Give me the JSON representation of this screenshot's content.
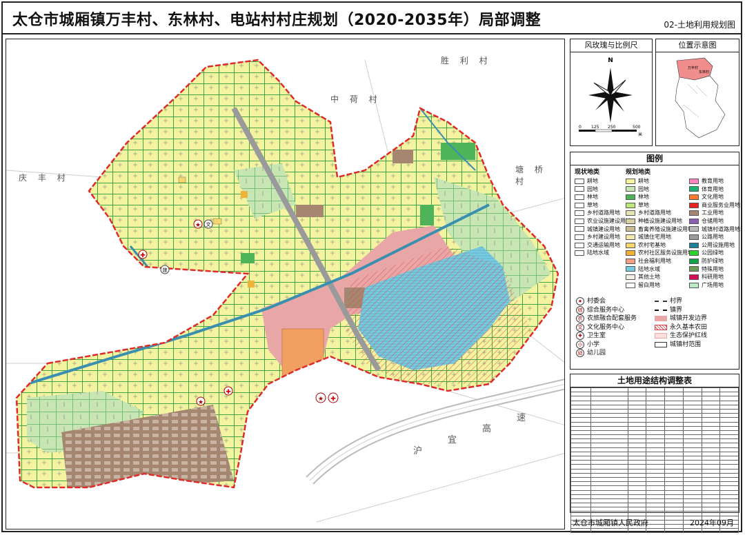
{
  "header": {
    "title": "太仓市城厢镇万丰村、东林村、电站村村庄规划（2020-2035年）局部调整",
    "subtitle": "02-土地利用规划图"
  },
  "map": {
    "villages": [
      "胜 利 村",
      "中 荷 村",
      "庆 丰 村",
      "塘 桥 村"
    ],
    "highway_label": [
      "沪",
      "宜",
      "高",
      "速"
    ],
    "colors": {
      "farmland": "#f3f3a0",
      "forest": "#4fb35a",
      "garden": "#9fd49b",
      "water": "#77cbe0",
      "town": "#e8a7a6",
      "industry": "#9c7e6b",
      "road": "#bdbdbd",
      "boundary": "#e02a2a",
      "river": "#3a8fb0"
    }
  },
  "inset": {
    "rose_title": "风玫瑰与比例尺",
    "location_title": "位置示意图",
    "north": "N",
    "scale_ticks": [
      "0",
      "125",
      "250",
      "500"
    ],
    "scale_unit": "米",
    "loc_labels": [
      "万丰村",
      "东林村"
    ]
  },
  "legend": {
    "title": "图例",
    "current_head": "现状地类",
    "planned_head": "规划地类",
    "current": [
      {
        "label": "耕地",
        "color": "#ffffff"
      },
      {
        "label": "园地",
        "color": "#ffffff"
      },
      {
        "label": "林地",
        "color": "#ffffff"
      },
      {
        "label": "草地",
        "color": "#ffffff"
      },
      {
        "label": "乡村道路用地",
        "color": "#ffffff"
      },
      {
        "label": "农业设施建设用地",
        "color": "#ffffff"
      },
      {
        "label": "城镇建设用地",
        "color": "#ffffff"
      },
      {
        "label": "乡村建设用地",
        "color": "#ffffff"
      },
      {
        "label": "交通运输用地",
        "color": "#ffffff"
      },
      {
        "label": "陆地水域",
        "color": "#ffffff"
      }
    ],
    "planned": [
      {
        "label": "耕地",
        "color": "#f3f3a0"
      },
      {
        "label": "园地",
        "color": "#c8e6b4"
      },
      {
        "label": "林地",
        "color": "#4fb35a"
      },
      {
        "label": "草地",
        "color": "#bfe87a"
      },
      {
        "label": "乡村道路用地",
        "color": "#e6e2b8"
      },
      {
        "label": "种植设施建设用地",
        "color": "#d8d0a6"
      },
      {
        "label": "畜禽养殖设施建设用地",
        "color": "#c9bc95"
      },
      {
        "label": "城镇住宅用地",
        "color": "#f5e9b0"
      },
      {
        "label": "农村宅基地",
        "color": "#f5d76e"
      },
      {
        "label": "农村社区服务设施用地",
        "color": "#f1b23a"
      },
      {
        "label": "社会福利用地",
        "color": "#f0a084"
      },
      {
        "label": "陆地水域",
        "color": "#77cbe0"
      },
      {
        "label": "其他土地",
        "color": "#f4f0e4"
      },
      {
        "label": "留白用地",
        "color": "#ffffff"
      }
    ],
    "planned2": [
      {
        "label": "教育用地",
        "color": "#ff85c0"
      },
      {
        "label": "体育用地",
        "color": "#1bb373"
      },
      {
        "label": "文化用地",
        "color": "#ff7b2e"
      },
      {
        "label": "商业服务业用地",
        "color": "#e8221c"
      },
      {
        "label": "工业用地",
        "color": "#a58670"
      },
      {
        "label": "仓储用地",
        "color": "#8b5fb6"
      },
      {
        "label": "城镇村道路用地",
        "color": "#b8b8b8"
      },
      {
        "label": "公路用地",
        "color": "#9a9a9a"
      },
      {
        "label": "公用设施用地",
        "color": "#1e7f9a"
      },
      {
        "label": "公园绿地",
        "color": "#2ed12e"
      },
      {
        "label": "防护绿地",
        "color": "#14a24a"
      },
      {
        "label": "特殊用地",
        "color": "#6e9c58"
      },
      {
        "label": "科研用地",
        "color": "#d60e5a"
      },
      {
        "label": "广场用地",
        "color": "#b9ebc6"
      }
    ],
    "symbols": [
      {
        "glyph": "★",
        "label": "村委会"
      },
      {
        "glyph": "综",
        "label": "综合服务中心"
      },
      {
        "glyph": "农",
        "label": "农旅融合配套服务"
      },
      {
        "glyph": "文",
        "label": "文化服务中心"
      },
      {
        "glyph": "✚",
        "label": "卫生室"
      },
      {
        "glyph": "小",
        "label": "小学"
      },
      {
        "glyph": "幼",
        "label": "幼儿园"
      }
    ],
    "boundaries": [
      {
        "label": "村界"
      },
      {
        "label": "镇界"
      },
      {
        "label": "城镇开发边界"
      },
      {
        "label": "永久基本农田"
      },
      {
        "label": "生态保护红线"
      },
      {
        "label": "城镇村范围"
      }
    ]
  },
  "table": {
    "title": "土地用途结构调整表",
    "rows": 34
  },
  "footer": {
    "agency": "太仓市城厢镇人民政府",
    "date": "2024年09月"
  }
}
